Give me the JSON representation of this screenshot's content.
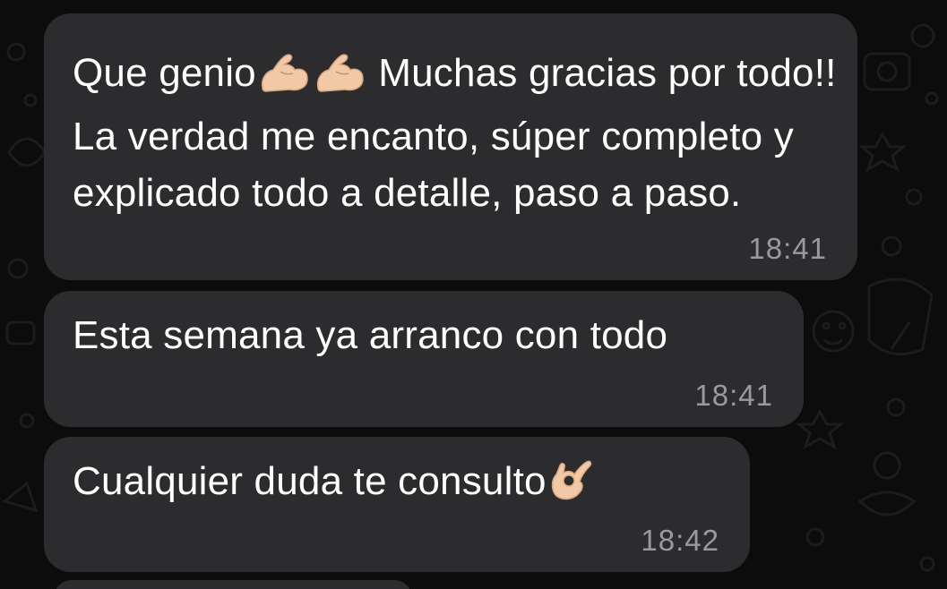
{
  "messages": [
    {
      "text_part1": "Que genio",
      "emoji1": "flexed-biceps",
      "emoji2": "flexed-biceps",
      "text_part2": " Muchas gracias por todo!! La verdad me encanto, súper completo y explicado todo a detalle, paso a paso.",
      "time": "18:41"
    },
    {
      "text": "Esta semana ya arranco con todo",
      "time": "18:41"
    },
    {
      "text": "Cualquier duda te consulto",
      "emoji": "ok-hand",
      "time": "18:42"
    }
  ],
  "colors": {
    "background": "#0c0c0c",
    "bubble": "#2c2c2e",
    "text": "#ffffff",
    "timestamp": "#9a9a9e"
  }
}
